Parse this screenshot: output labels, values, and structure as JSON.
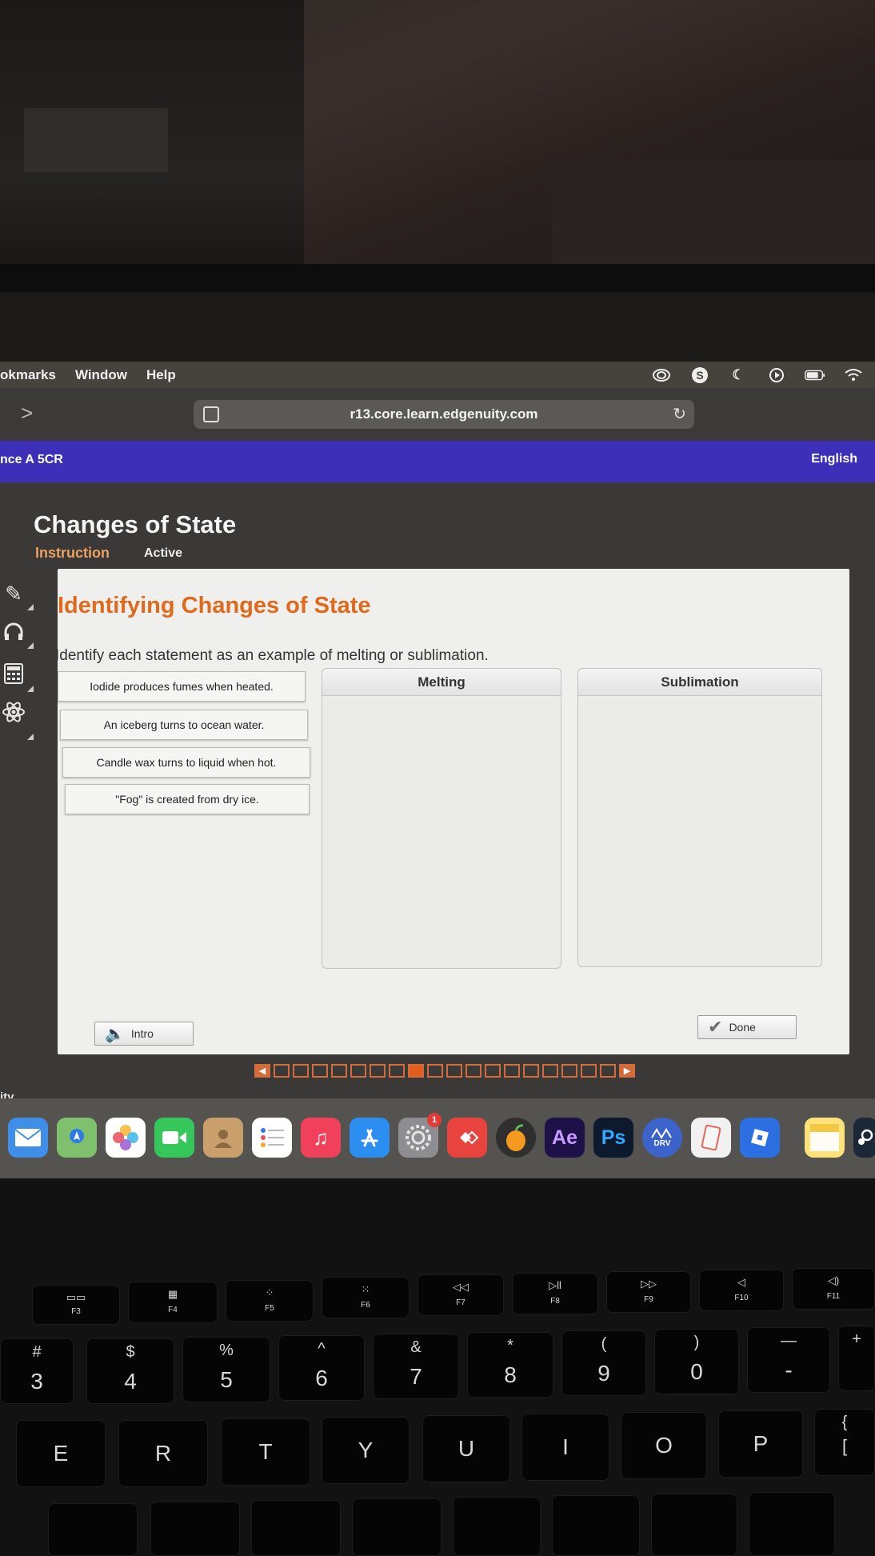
{
  "menubar": {
    "items": [
      "okmarks",
      "Window",
      "Help"
    ]
  },
  "browser": {
    "url": "r13.core.learn.edgenuity.com"
  },
  "site": {
    "course": "nce A 5CR",
    "language": "English"
  },
  "lesson": {
    "title": "Changes of State",
    "tab_instruction": "Instruction",
    "tab_active": "Active"
  },
  "activity": {
    "title": "Identifying Changes of State",
    "instructions": "Identify each statement as an example of melting or sublimation.",
    "items": [
      "Iodide produces fumes when heated.",
      "An iceberg turns to ocean water.",
      "Candle wax turns to liquid when hot.",
      "\"Fog\" is created from dry ice."
    ],
    "bins": [
      "Melting",
      "Sublimation"
    ],
    "intro_label": "Intro",
    "done_label": "Done"
  },
  "pager": {
    "total": 18,
    "current": 8
  },
  "page_footer": "ity",
  "dock": {
    "badge": "1",
    "apps": [
      "mail-icon",
      "maps-icon",
      "photos-icon",
      "facetime-icon",
      "contacts-icon",
      "reminders-icon",
      "music-icon",
      "app-store-icon",
      "system-settings-icon",
      "anydesk-icon",
      "fl-studio-icon",
      "after-effects-icon",
      "photoshop-icon",
      "drv-icon",
      "files-icon",
      "roblox-icon",
      "notes-icon",
      "steam-icon"
    ],
    "labels": {
      "ae": "Ae",
      "ps": "Ps",
      "drv": "DRV"
    }
  },
  "keyboard": {
    "fn_row": [
      "F3",
      "F4",
      "F5",
      "F6",
      "F7",
      "F8",
      "F9",
      "F10",
      "F11"
    ],
    "num_row_symbols": [
      "#",
      "$",
      "%",
      "^",
      "&",
      "*",
      "(",
      ")",
      "—",
      "+"
    ],
    "num_row_digits": [
      "3",
      "4",
      "5",
      "6",
      "7",
      "8",
      "9",
      "0",
      "",
      ""
    ],
    "letter_row": [
      "E",
      "R",
      "T",
      "Y",
      "U",
      "I",
      "O",
      "P",
      "{"
    ],
    "letter_row_extra": "["
  }
}
